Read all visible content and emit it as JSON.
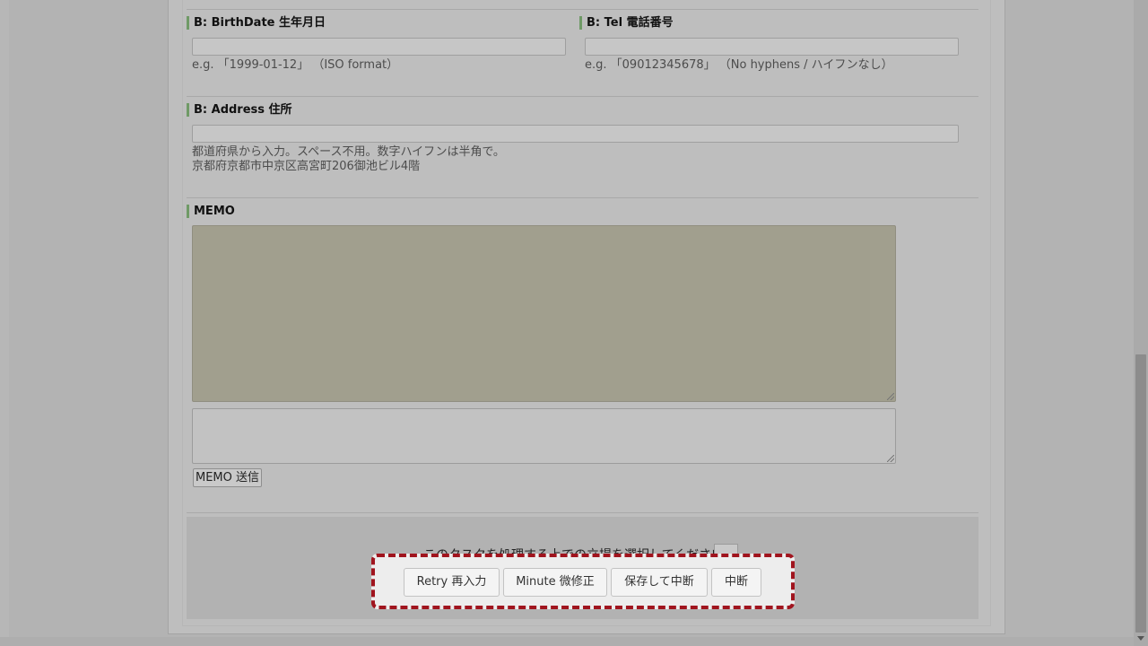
{
  "fields": {
    "birthdate": {
      "label": "B: BirthDate 生年月日",
      "value": "",
      "hint": "e.g. 「1999-01-12」 （ISO format）"
    },
    "tel": {
      "label": "B: Tel 電話番号",
      "value": "",
      "hint": "e.g. 「09012345678」 （No hyphens / ハイフンなし）"
    },
    "address": {
      "label": "B: Address 住所",
      "value": "",
      "hint_line1": "都道府県から入力。スペース不用。数字ハイフンは半角で。",
      "hint_line2": "京都府京都市中京区高宮町206御池ビル4階"
    }
  },
  "memo": {
    "label": "MEMO",
    "history": "",
    "input_value": "",
    "send_label": "MEMO 送信"
  },
  "footer": {
    "role_prompt": "このタスクを処理する上での立場を選択してください*",
    "role_selected": "",
    "actions": [
      {
        "label": "Retry 再入力"
      },
      {
        "label": "Minute 微修正"
      },
      {
        "label": "保存して中断"
      },
      {
        "label": "中断"
      }
    ]
  },
  "colors": {
    "highlight_border": "#a0141e",
    "label_accent": "#6f9a66",
    "memo_history_bg": "#a19f8e"
  }
}
